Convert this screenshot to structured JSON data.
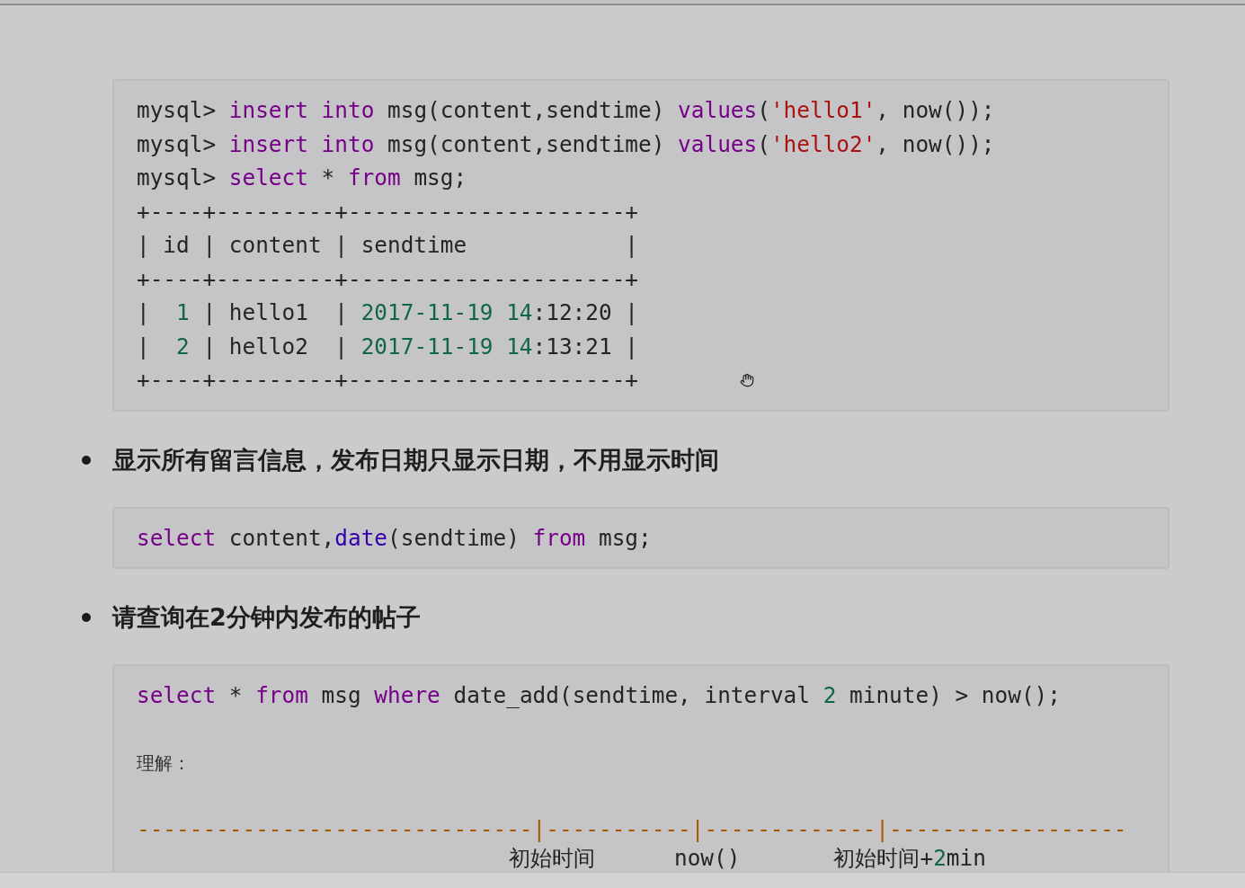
{
  "sections": [
    {
      "kind": "code",
      "lines": [
        [
          {
            "text": "mysql> ",
            "kind": "plain"
          },
          {
            "text": "insert into",
            "kind": "keyword"
          },
          {
            "text": " msg(content,sendtime) ",
            "kind": "plain"
          },
          {
            "text": "values",
            "kind": "keyword"
          },
          {
            "text": "(",
            "kind": "plain"
          },
          {
            "text": "'hello1'",
            "kind": "string"
          },
          {
            "text": ", now());",
            "kind": "plain"
          }
        ],
        [
          {
            "text": "mysql> ",
            "kind": "plain"
          },
          {
            "text": "insert into",
            "kind": "keyword"
          },
          {
            "text": " msg(content,sendtime) ",
            "kind": "plain"
          },
          {
            "text": "values",
            "kind": "keyword"
          },
          {
            "text": "(",
            "kind": "plain"
          },
          {
            "text": "'hello2'",
            "kind": "string"
          },
          {
            "text": ", now());",
            "kind": "plain"
          }
        ],
        [
          {
            "text": "mysql> ",
            "kind": "plain"
          },
          {
            "text": "select",
            "kind": "keyword"
          },
          {
            "text": " * ",
            "kind": "plain"
          },
          {
            "text": "from",
            "kind": "keyword"
          },
          {
            "text": " msg;",
            "kind": "plain"
          }
        ],
        [
          {
            "text": "+----+---------+---------------------+",
            "kind": "plain"
          }
        ],
        [
          {
            "text": "| id | content | sendtime            |",
            "kind": "plain"
          }
        ],
        [
          {
            "text": "+----+---------+---------------------+",
            "kind": "plain"
          }
        ],
        [
          {
            "text": "|  ",
            "kind": "plain"
          },
          {
            "text": "1",
            "kind": "number"
          },
          {
            "text": " | hello1  | ",
            "kind": "plain"
          },
          {
            "text": "2017-11-19 14",
            "kind": "number"
          },
          {
            "text": ":12:20 |",
            "kind": "plain"
          }
        ],
        [
          {
            "text": "|  ",
            "kind": "plain"
          },
          {
            "text": "2",
            "kind": "number"
          },
          {
            "text": " | hello2  | ",
            "kind": "plain"
          },
          {
            "text": "2017-11-19 14",
            "kind": "number"
          },
          {
            "text": ":13:21 |",
            "kind": "plain"
          }
        ],
        [
          {
            "text": "+----+---------+---------------------+",
            "kind": "plain"
          }
        ]
      ]
    },
    {
      "kind": "bullet",
      "text": "显示所有留言信息，发布日期只显示日期，不用显示时间"
    },
    {
      "kind": "code",
      "lines": [
        [
          {
            "text": "select",
            "kind": "keyword"
          },
          {
            "text": " content,",
            "kind": "plain"
          },
          {
            "text": "date",
            "kind": "builtin"
          },
          {
            "text": "(sendtime) ",
            "kind": "plain"
          },
          {
            "text": "from",
            "kind": "keyword"
          },
          {
            "text": " msg;",
            "kind": "plain"
          }
        ]
      ]
    },
    {
      "kind": "bullet",
      "text": "请查询在2分钟内发布的帖子"
    },
    {
      "kind": "code",
      "lines": [
        [
          {
            "text": "select",
            "kind": "keyword"
          },
          {
            "text": " * ",
            "kind": "plain"
          },
          {
            "text": "from",
            "kind": "keyword"
          },
          {
            "text": " msg ",
            "kind": "plain"
          },
          {
            "text": "where",
            "kind": "keyword"
          },
          {
            "text": " date_add(sendtime, interval ",
            "kind": "plain"
          },
          {
            "text": "2",
            "kind": "number"
          },
          {
            "text": " minute) > now();",
            "kind": "plain"
          }
        ]
      ],
      "note": "理解：",
      "timeline": {
        "line": [
          {
            "text": "------------------------------|-----------|-------------|------------------",
            "kind": "comment"
          }
        ],
        "labels": [
          [
            {
              "text": "初始时间",
              "kind": "plain"
            }
          ],
          [
            {
              "text": "now()",
              "kind": "plain"
            }
          ],
          [
            {
              "text": "初始时间+",
              "kind": "plain"
            },
            {
              "text": "2",
              "kind": "number"
            },
            {
              "text": "min",
              "kind": "plain"
            }
          ]
        ]
      }
    }
  ]
}
